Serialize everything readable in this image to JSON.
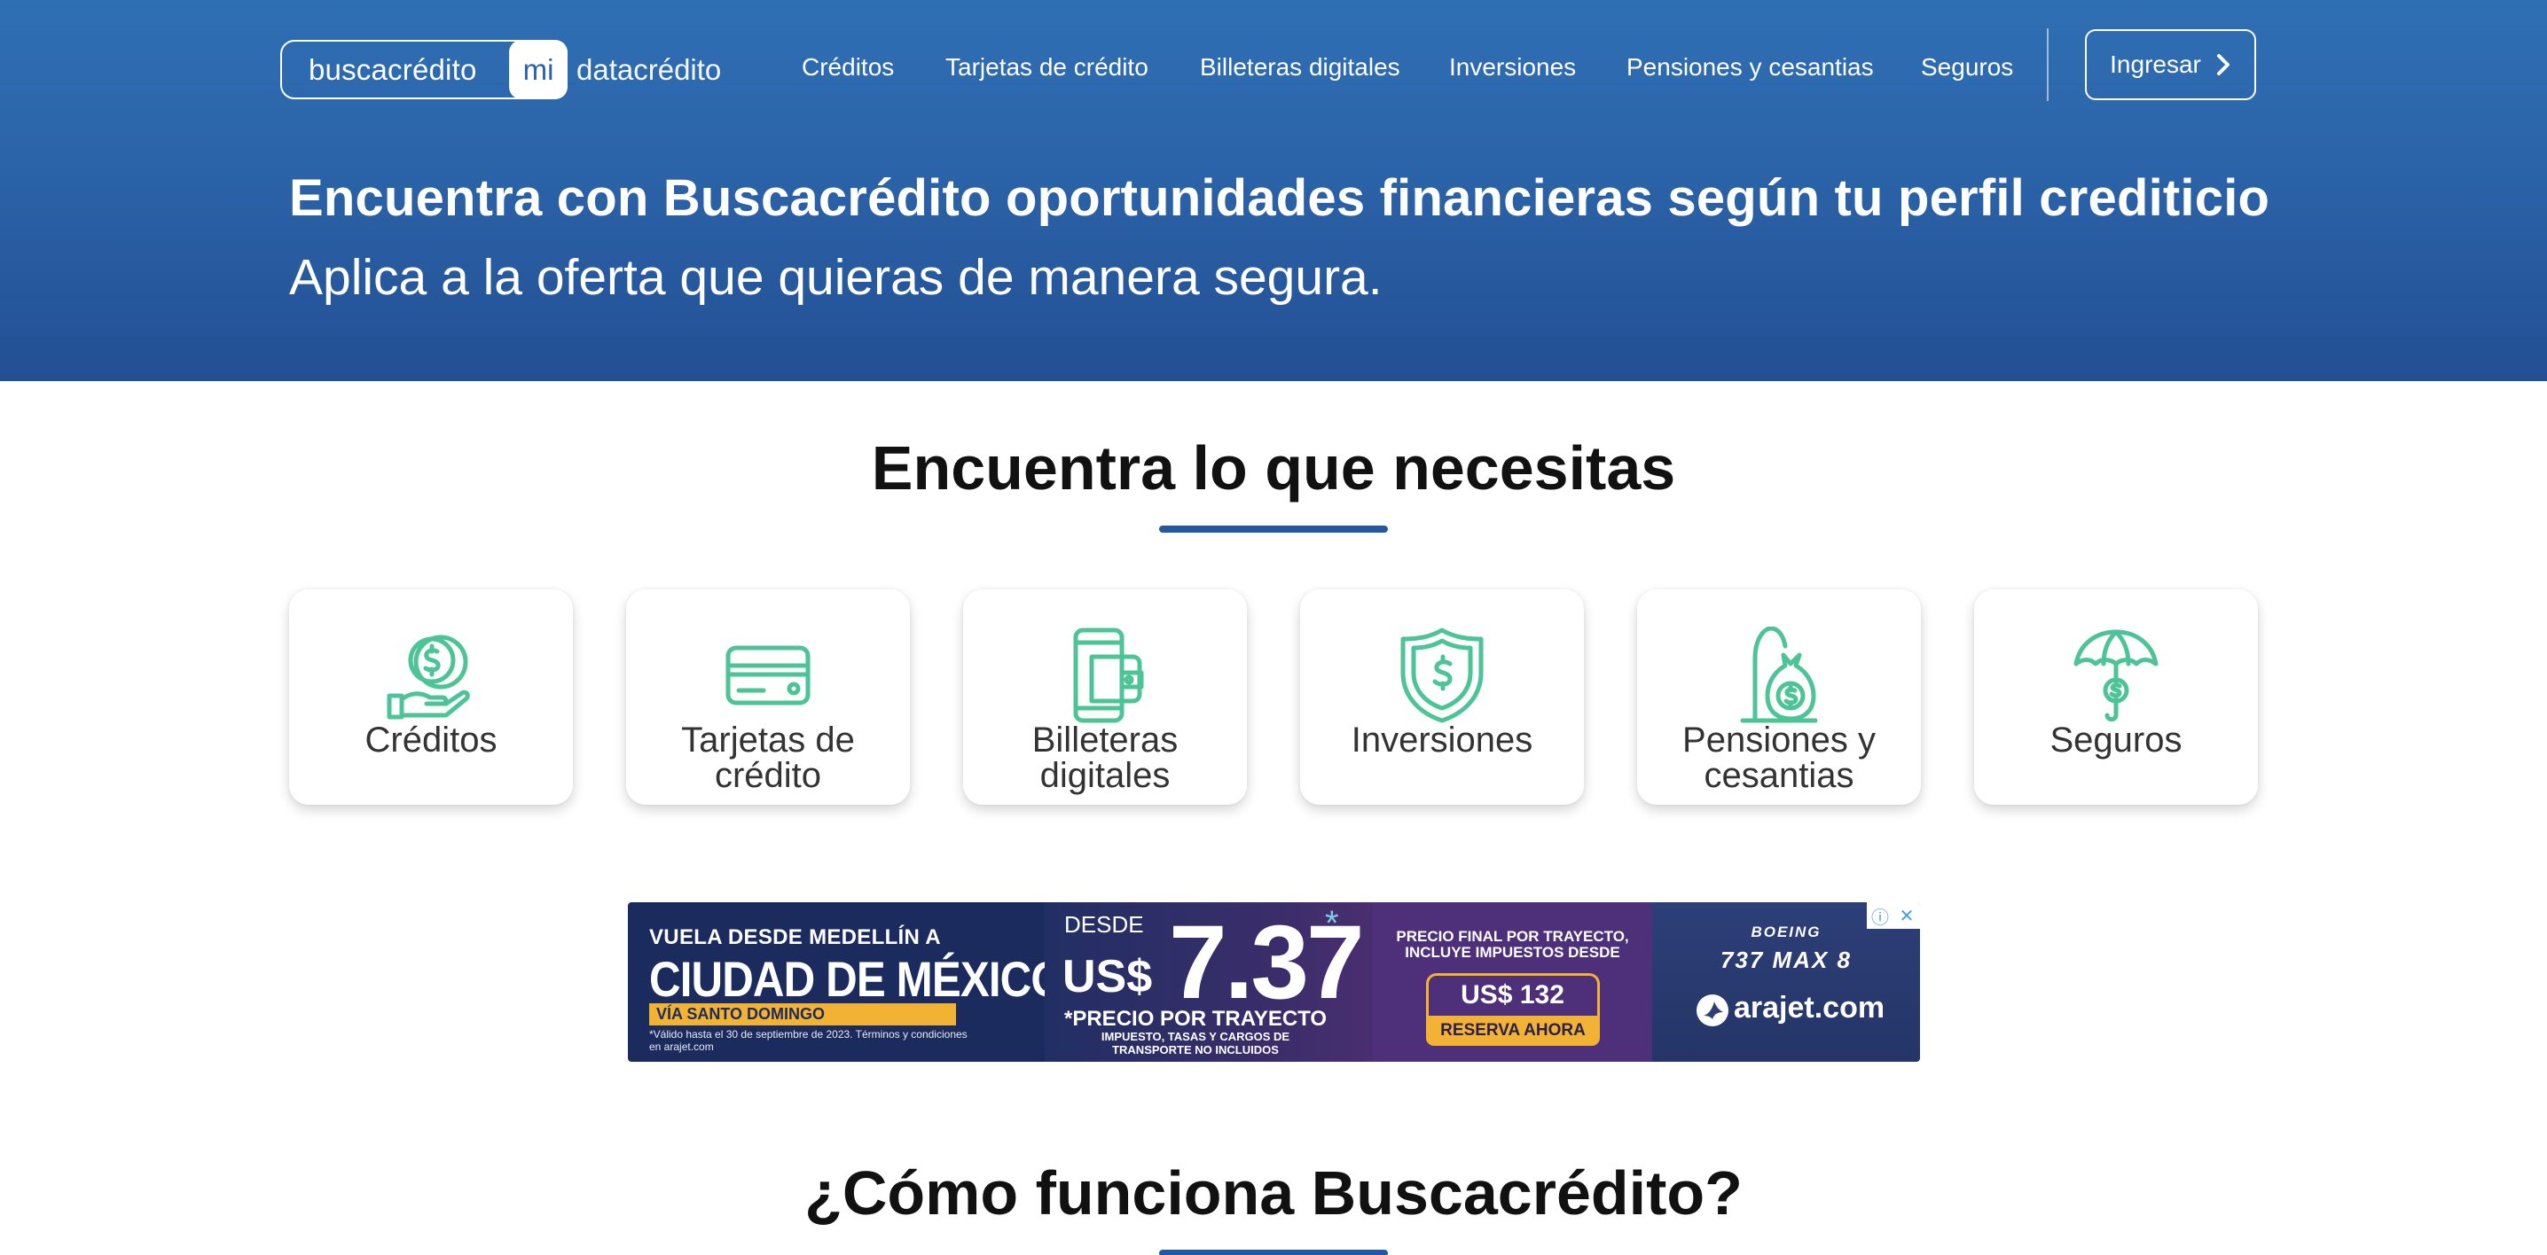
{
  "header": {
    "logo": {
      "busca": "buscacrédito",
      "mi": "mi",
      "data": "datacrédito"
    },
    "nav": [
      {
        "label": "Créditos"
      },
      {
        "label": "Tarjetas de crédito"
      },
      {
        "label": "Billeteras digitales"
      },
      {
        "label": "Inversiones"
      },
      {
        "label": "Pensiones y cesantias"
      },
      {
        "label": "Seguros"
      }
    ],
    "login_label": "Ingresar"
  },
  "hero": {
    "title": "Encuentra con Buscacrédito oportunidades financieras según tu perfil crediticio",
    "subtitle": "Aplica a la oferta que quieras de manera segura."
  },
  "categories_section": {
    "title": "Encuentra lo que necesitas",
    "cards": [
      {
        "label": "Créditos",
        "icon": "hand-coin-icon"
      },
      {
        "label": "Tarjetas de crédito",
        "icon": "credit-card-icon"
      },
      {
        "label": "Billeteras digitales",
        "icon": "phone-wallet-icon"
      },
      {
        "label": "Inversiones",
        "icon": "shield-dollar-icon"
      },
      {
        "label": "Pensiones y cesantias",
        "icon": "money-bag-icon"
      },
      {
        "label": "Seguros",
        "icon": "umbrella-dollar-icon"
      }
    ]
  },
  "ad": {
    "line1": "VUELA DESDE MEDELLÍN A",
    "line2": "CIUDAD DE MÉXICO",
    "line3": "VÍA SANTO DOMINGO",
    "disclaimer": "*Válido hasta el 30 de septiembre de 2023. Términos y condiciones en arajet.com",
    "desde": "DESDE",
    "currency": "US$",
    "price": "7.37",
    "star": "*",
    "price_note": "*PRECIO POR TRAYECTO",
    "price_note2": "IMPUESTO, TASAS Y CARGOS DE TRANSPORTE NO INCLUIDOS",
    "final_label": "PRECIO FINAL POR TRAYECTO, INCLUYE IMPUESTOS DESDE",
    "final_price": "US$ 132",
    "cta": "RESERVA AHORA",
    "boeing": "BOEING",
    "model": "737 MAX 8",
    "brand": "arajet.com",
    "info_icon": "ⓘ",
    "close_icon": "✕"
  },
  "how_section": {
    "title": "¿Cómo funciona Buscacrédito?"
  },
  "colors": {
    "primary": "#2b63a8",
    "accent_green": "#4cc497",
    "underline": "#2259a2"
  }
}
